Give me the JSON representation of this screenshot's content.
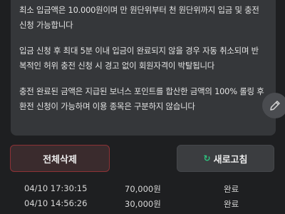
{
  "notice": {
    "paragraphs": [
      "최소 입금액은 10.000원이며 만 원단위부터 천 원단위까지 입금 및 충전 신청 가능합니다",
      "입금 신청 후 최대 5분 이내 입금이 완료되지 않을 경우 자동 취소되며 반복적인 허위 충전 신청 시 경고 없이 회원자격이 박탈됩니다",
      "충전 완료된 금액은 지급된 보너스 포인트를 합산한 금액의 100% 롤링 후 환전 신청이 가능하며 이용 종목은 구분하지 않습니다"
    ]
  },
  "actions": {
    "delete_all_label": "전체삭제",
    "refresh_label": "새로고침",
    "refresh_icon": "refresh-icon"
  },
  "history": {
    "rows": [
      {
        "time": "04/10 17:30:15",
        "amount": "70,000원",
        "status": "완료"
      },
      {
        "time": "04/10 14:56:26",
        "amount": "30,000원",
        "status": "완료"
      }
    ]
  },
  "colors": {
    "background": "#1e1f21",
    "panel": "#35373a",
    "delete_border": "#8e3236",
    "refresh_icon": "#2ec27e"
  }
}
